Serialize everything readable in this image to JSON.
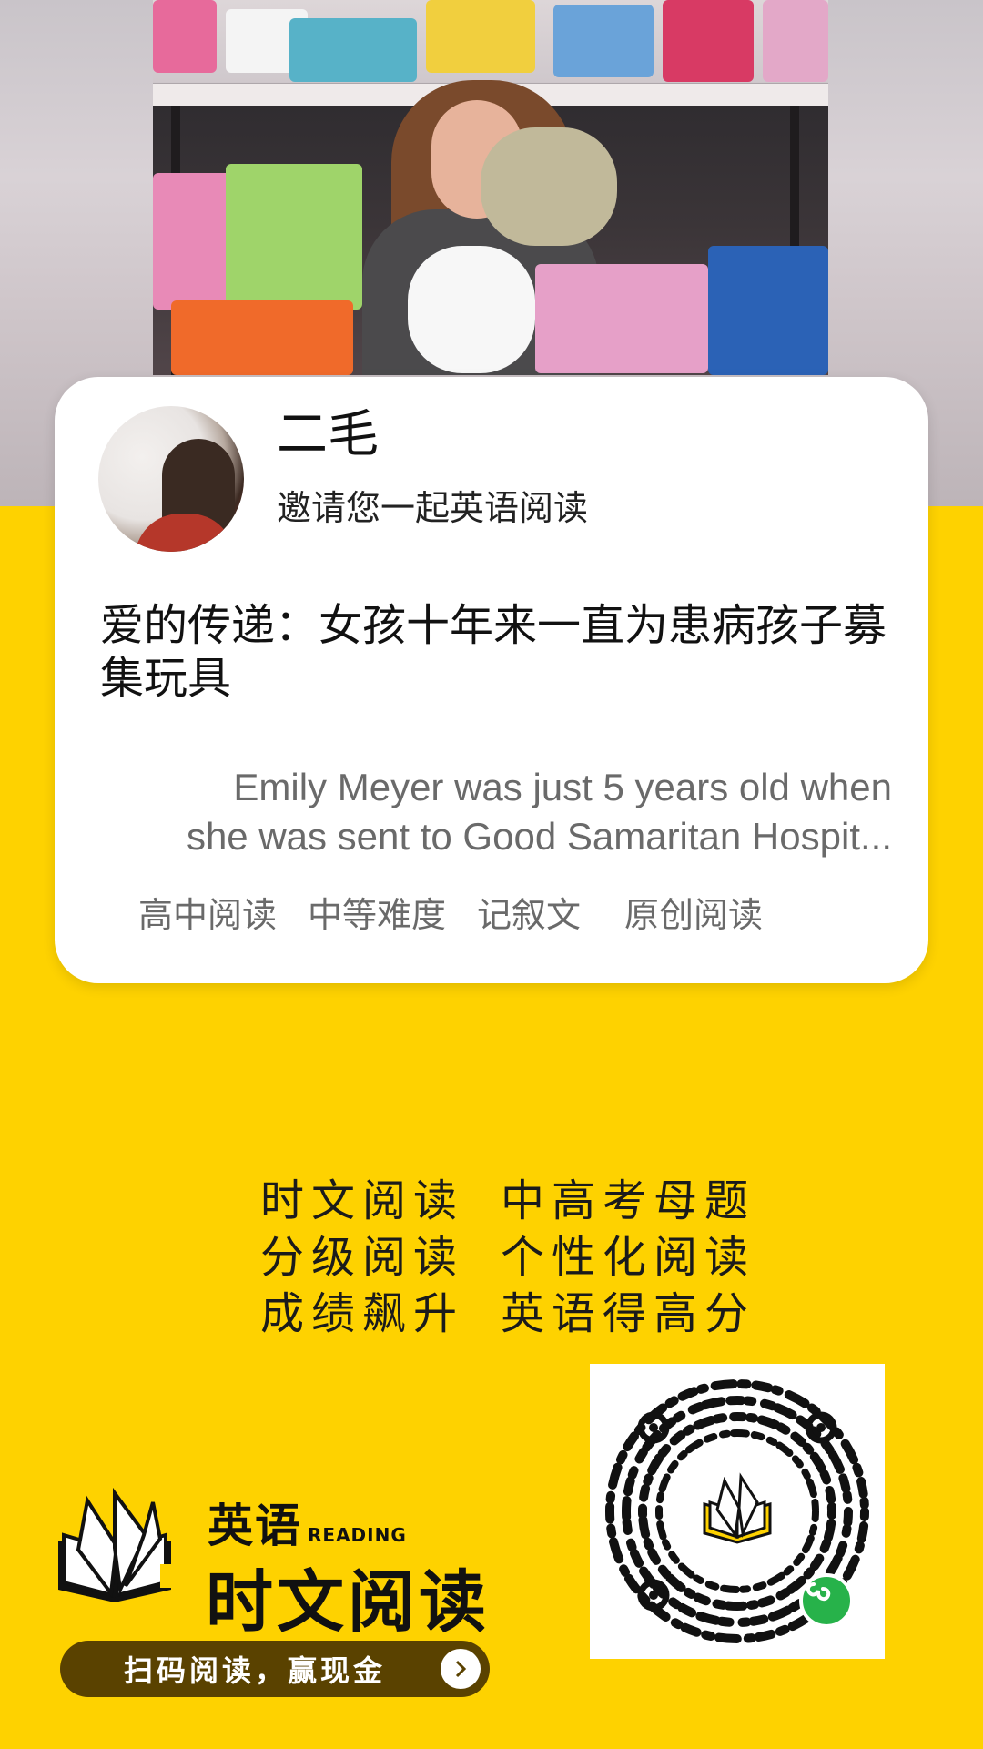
{
  "share_card": {
    "user_name": "二毛",
    "invite_text": "邀请您一起英语阅读",
    "article_title": "爱的传递：女孩十年来一直为患病孩子募集玩具",
    "excerpt": "Emily Meyer was just 5 years old when she was sent to Good Samaritan Hospit...",
    "tags": [
      "高中阅读",
      "中等难度",
      "记叙文",
      "原创阅读"
    ]
  },
  "slogans": [
    [
      "时文阅读",
      "中高考母题"
    ],
    [
      "分级阅读",
      "个性化阅读"
    ],
    [
      "成绩飙升",
      "英语得高分"
    ]
  ],
  "brand": {
    "top_text": "英语",
    "reading_text": "READING",
    "main_text": "时文阅读"
  },
  "cta": {
    "label": "扫码阅读，赢现金"
  },
  "colors": {
    "background": "#fed200",
    "card": "#ffffff",
    "cta_bg": "#5a4200",
    "badge_green": "#27b24a"
  },
  "icons": {
    "cta_arrow": "chevron-right-icon",
    "logo": "open-book-icon",
    "mini_program": "mini-program-icon"
  }
}
